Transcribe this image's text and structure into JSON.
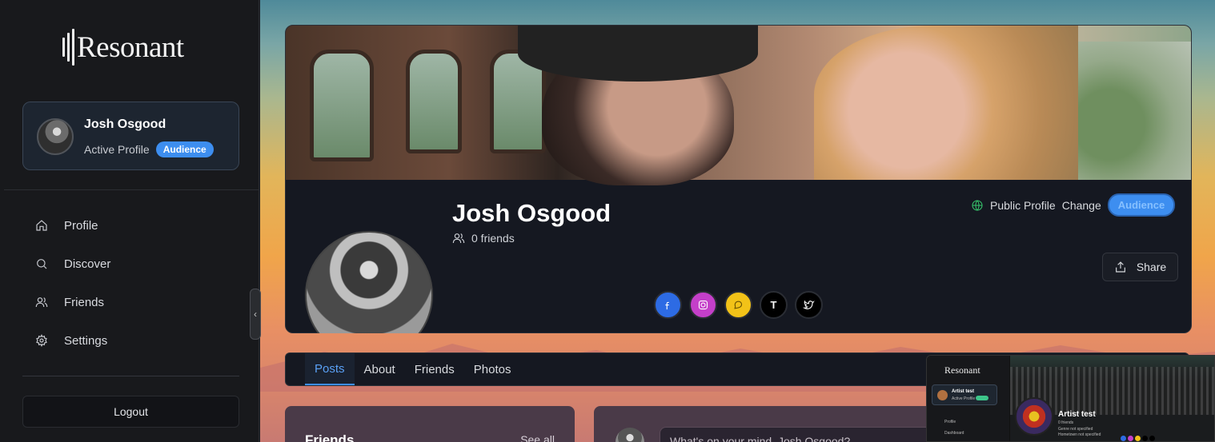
{
  "sidebar": {
    "logo": "Resonant",
    "profile_card": {
      "name": "Josh Osgood",
      "subtitle": "Active Profile",
      "badge": "Audience"
    },
    "nav": [
      {
        "label": "Profile",
        "icon": "home-icon"
      },
      {
        "label": "Discover",
        "icon": "search-icon"
      },
      {
        "label": "Friends",
        "icon": "users-icon"
      },
      {
        "label": "Settings",
        "icon": "gear-icon"
      }
    ],
    "logout_label": "Logout"
  },
  "profile": {
    "name": "Josh Osgood",
    "friends_text": "0 friends",
    "visibility": "Public Profile",
    "change_label": "Change",
    "badge": "Audience",
    "share_label": "Share",
    "socials": [
      {
        "name": "facebook",
        "color": "#2d6be4"
      },
      {
        "name": "instagram",
        "color": "#c43fc9"
      },
      {
        "name": "chat",
        "color": "#f2c218"
      },
      {
        "name": "tiktok",
        "color": "#000000",
        "glyph": "T"
      },
      {
        "name": "twitter",
        "color": "#000000"
      }
    ]
  },
  "tabs": [
    "Posts",
    "About",
    "Friends",
    "Photos"
  ],
  "friends_card": {
    "title": "Friends",
    "see_all": "See all"
  },
  "composer": {
    "placeholder": "What's on your mind, Josh Osgood?"
  },
  "thumbnail": {
    "logo": "Resonant",
    "card_name": "Artist test",
    "card_sub": "Active Profile",
    "nav1": "Profile",
    "nav2": "Dashboard",
    "name": "Artist test",
    "line1": "0 friends",
    "line2": "Genre not specified",
    "line3": "Hometown not specified"
  },
  "colors": {
    "accent": "#3d8ef0",
    "public_icon": "#36c16a"
  }
}
